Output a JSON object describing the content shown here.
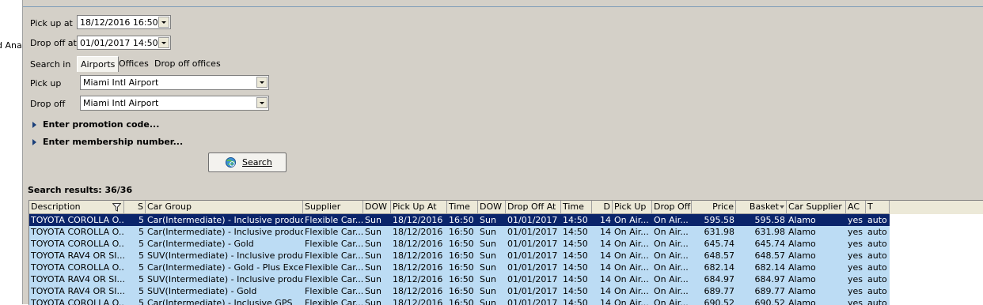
{
  "left_fragment": "d Ana",
  "form": {
    "pickup_at_label": "Pick up at",
    "pickup_at_value": "18/12/2016 16:50",
    "dropoff_at_label": "Drop off at",
    "dropoff_at_value": "01/01/2017 14:50",
    "search_in_label": "Search in",
    "tabs": [
      "Airports",
      "Offices",
      "Drop off offices"
    ],
    "pickup_label": "Pick up",
    "pickup_value": "Miami Intl Airport",
    "dropoff_label": "Drop off",
    "dropoff_value": "Miami Intl Airport",
    "promo_label": "Enter promotion code...",
    "membership_label": "Enter membership number...",
    "search_button": "Search"
  },
  "results": {
    "summary": "Search results: 36/36",
    "columns": [
      "Description",
      "S",
      "Car Group",
      "Supplier",
      "DOW",
      "Pick Up At",
      "Time",
      "DOW",
      "Drop Off At",
      "Time",
      "D",
      "Pick Up",
      "Drop Off",
      "Price",
      "Basket",
      "Car Supplier",
      "AC",
      "T"
    ],
    "rows": [
      [
        "TOYOTA COROLLA O...",
        "5",
        "Car(Intermediate) - Inclusive product",
        "Flexible Car...",
        "Sun",
        "18/12/2016",
        "16:50",
        "Sun",
        "01/01/2017",
        "14:50",
        "14",
        "On Air...",
        "On Air...",
        "595.58",
        "595.58",
        "Alamo",
        "yes",
        "auto"
      ],
      [
        "TOYOTA COROLLA O...",
        "5",
        "Car(Intermediate) - Inclusive product ...",
        "Flexible Car...",
        "Sun",
        "18/12/2016",
        "16:50",
        "Sun",
        "01/01/2017",
        "14:50",
        "14",
        "On Air...",
        "On Air...",
        "631.98",
        "631.98",
        "Alamo",
        "yes",
        "auto"
      ],
      [
        "TOYOTA COROLLA O...",
        "5",
        "Car(Intermediate) - Gold",
        "Flexible Car...",
        "Sun",
        "18/12/2016",
        "16:50",
        "Sun",
        "01/01/2017",
        "14:50",
        "14",
        "On Air...",
        "On Air...",
        "645.74",
        "645.74",
        "Alamo",
        "yes",
        "auto"
      ],
      [
        "TOYOTA RAV4 OR SI...",
        "5",
        "SUV(Intermediate) - Inclusive product",
        "Flexible Car...",
        "Sun",
        "18/12/2016",
        "16:50",
        "Sun",
        "01/01/2017",
        "14:50",
        "14",
        "On Air...",
        "On Air...",
        "648.57",
        "648.57",
        "Alamo",
        "yes",
        "auto"
      ],
      [
        "TOYOTA COROLLA O...",
        "5",
        "Car(Intermediate) - Gold - Plus Exces...",
        "Flexible Car...",
        "Sun",
        "18/12/2016",
        "16:50",
        "Sun",
        "01/01/2017",
        "14:50",
        "14",
        "On Air...",
        "On Air...",
        "682.14",
        "682.14",
        "Alamo",
        "yes",
        "auto"
      ],
      [
        "TOYOTA RAV4 OR SI...",
        "5",
        "SUV(Intermediate) - Inclusive product...",
        "Flexible Car...",
        "Sun",
        "18/12/2016",
        "16:50",
        "Sun",
        "01/01/2017",
        "14:50",
        "14",
        "On Air...",
        "On Air...",
        "684.97",
        "684.97",
        "Alamo",
        "yes",
        "auto"
      ],
      [
        "TOYOTA RAV4 OR SI...",
        "5",
        "SUV(Intermediate) - Gold",
        "Flexible Car...",
        "Sun",
        "18/12/2016",
        "16:50",
        "Sun",
        "01/01/2017",
        "14:50",
        "14",
        "On Air...",
        "On Air...",
        "689.77",
        "689.77",
        "Alamo",
        "yes",
        "auto"
      ],
      [
        "TOYOTA COROLLA O...",
        "5",
        "Car(Intermediate) - Inclusive GPS",
        "Flexible Car...",
        "Sun",
        "18/12/2016",
        "16:50",
        "Sun",
        "01/01/2017",
        "14:50",
        "14",
        "On Air...",
        "On Air...",
        "690.52",
        "690.52",
        "Alamo",
        "yes",
        "auto"
      ]
    ]
  },
  "colors": {
    "selected_row": "#0a246a",
    "row_bg": "#bcdcf4",
    "panel": "#d4d0c8"
  }
}
